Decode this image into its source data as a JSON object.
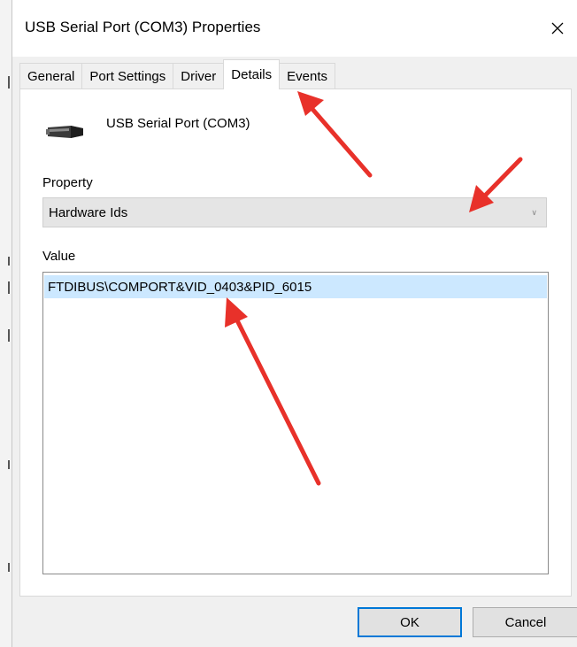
{
  "window": {
    "title": "USB Serial Port (COM3) Properties",
    "close_icon": "close-icon"
  },
  "tabs": [
    {
      "label": "General",
      "active": false
    },
    {
      "label": "Port Settings",
      "active": false
    },
    {
      "label": "Driver",
      "active": false
    },
    {
      "label": "Details",
      "active": true
    },
    {
      "label": "Events",
      "active": false
    }
  ],
  "device": {
    "icon": "serial-port-connector-icon",
    "name": "USB Serial Port (COM3)"
  },
  "property": {
    "label": "Property",
    "selected": "Hardware Ids",
    "dropdown_icon": "chevron-down-icon"
  },
  "value": {
    "label": "Value",
    "items": [
      "FTDIBUS\\COMPORT&VID_0403&PID_6015"
    ]
  },
  "buttons": {
    "ok": "OK",
    "cancel": "Cancel"
  },
  "annotations": {
    "arrow_color": "#e8312a"
  },
  "colors": {
    "selection": "#cce8ff",
    "ok_border": "#0078d7"
  }
}
